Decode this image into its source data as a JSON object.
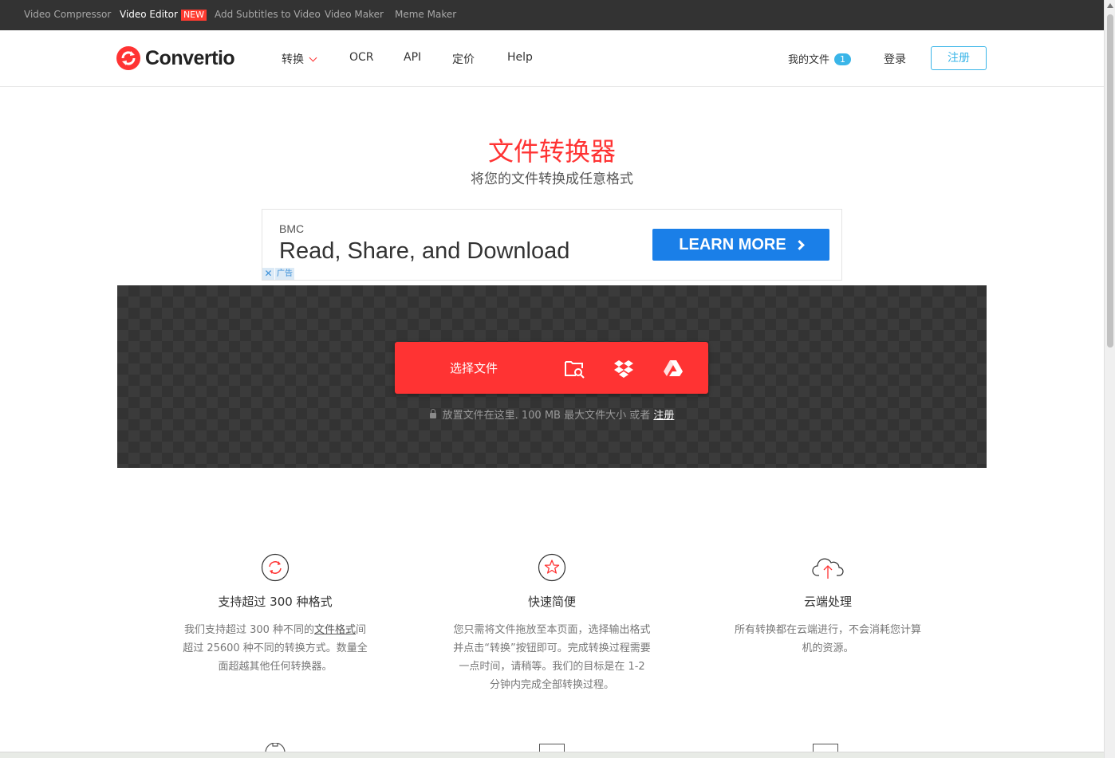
{
  "topbar": {
    "links": [
      {
        "label": "Video Compressor",
        "active": false
      },
      {
        "label": "Video Editor",
        "active": true,
        "badge": "NEW"
      },
      {
        "label": "Add Subtitles to Video",
        "active": false
      },
      {
        "label": "Video Maker",
        "active": false
      },
      {
        "label": "Meme Maker",
        "active": false
      }
    ]
  },
  "header": {
    "logo_text": "Convertio",
    "nav": {
      "convert": "转换",
      "ocr": "OCR",
      "api": "API",
      "pricing": "定价",
      "help": "Help"
    },
    "my_files": "我的文件",
    "my_files_count": "1",
    "login": "登录",
    "signup": "注册"
  },
  "hero": {
    "title": "文件转换器",
    "subtitle": "将您的文件转换成任意格式"
  },
  "ad": {
    "brand": "BMC",
    "headline": "Read, Share, and Download",
    "cta": "LEARN MORE",
    "close": "✕",
    "label": "广告"
  },
  "upload": {
    "choose_files": "选择文件",
    "note_prefix": "放置文件在这里. 100 MB 最大文件大小 或者",
    "note_link": "注册"
  },
  "features": [
    {
      "icon": "refresh-icon",
      "title": "支持超过 300 种格式",
      "text_before": "我们支持超过 300 种不同的",
      "text_link": "文件格式",
      "text_after": "间超过 25600 种不同的转换方式。数量全面超越其他任何转换器。"
    },
    {
      "icon": "star-icon",
      "title": "快速简便",
      "text": "您只需将文件拖放至本页面，选择输出格式并点击“转换”按钮即可。完成转换过程需要一点时间，请稍等。我们的目标是在 1-2 分钟内完成全部转换过程。"
    },
    {
      "icon": "cloud-upload-icon",
      "title": "云端处理",
      "text": "所有转换都在云端进行，不会消耗您计算机的资源。"
    }
  ],
  "colors": {
    "brand_red": "#ff3333",
    "accent_blue": "#3ab5e8",
    "ad_blue": "#1a7fe8",
    "topbar_bg": "#333333"
  }
}
